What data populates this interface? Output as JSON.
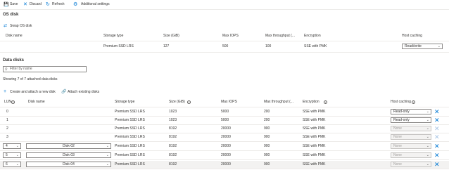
{
  "toolbar": {
    "save": "Save",
    "discard": "Discard",
    "refresh": "Refresh",
    "settings": "Additional settings"
  },
  "os_disk": {
    "title": "OS disk",
    "swap": "Swap OS disk",
    "headers": [
      "Disk name",
      "Storage type",
      "Size (GiB)",
      "Max IOPS",
      "Max throughput (...",
      "Encryption",
      "Host caching"
    ],
    "row": {
      "storage": "Premium SSD LRS",
      "size": "127",
      "iops": "500",
      "throughput": "100",
      "encryption": "SSE with PMK",
      "caching": "Read/write"
    }
  },
  "data_disks": {
    "title": "Data disks",
    "filter_placeholder": "Filter by name",
    "showing": "Showing 7 of 7 attached data disks",
    "create": "Create and attach a new disk",
    "attach": "Attach existing disks",
    "headers": [
      "LUN",
      "Disk name",
      "Storage type",
      "Size (GiB)",
      "Max IOPS",
      "Max throughput (...",
      "Encryption",
      "Host caching"
    ],
    "rows": [
      {
        "lun": "0",
        "name": "",
        "storage": "Premium SSD LRS",
        "size": "1023",
        "iops": "5000",
        "throughput": "200",
        "encryption": "SSE with PMK",
        "caching": "Read-only"
      },
      {
        "lun": "1",
        "name": "",
        "storage": "Premium SSD LRS",
        "size": "1023",
        "iops": "5000",
        "throughput": "200",
        "encryption": "SSE with PMK",
        "caching": "Read-only"
      },
      {
        "lun": "2",
        "name": "",
        "storage": "Premium SSD LRS",
        "size": "8192",
        "iops": "20000",
        "throughput": "900",
        "encryption": "SSE with PMK",
        "caching": "None"
      },
      {
        "lun": "3",
        "name": "",
        "storage": "Premium SSD LRS",
        "size": "8192",
        "iops": "20000",
        "throughput": "900",
        "encryption": "SSE with PMK",
        "caching": "None"
      },
      {
        "lun": "4",
        "name": "Disk-02",
        "storage": "Premium SSD LRS",
        "size": "8192",
        "iops": "20000",
        "throughput": "900",
        "encryption": "SSE with PMK",
        "caching": "None"
      },
      {
        "lun": "5",
        "name": "Disk-03",
        "storage": "Premium SSD LRS",
        "size": "8192",
        "iops": "20000",
        "throughput": "900",
        "encryption": "SSE with PMK",
        "caching": "None"
      },
      {
        "lun": "6",
        "name": "Disk-04",
        "storage": "Premium SSD LRS",
        "size": "8192",
        "iops": "20000",
        "throughput": "900",
        "encryption": "SSE with PMK",
        "caching": "None"
      }
    ]
  }
}
